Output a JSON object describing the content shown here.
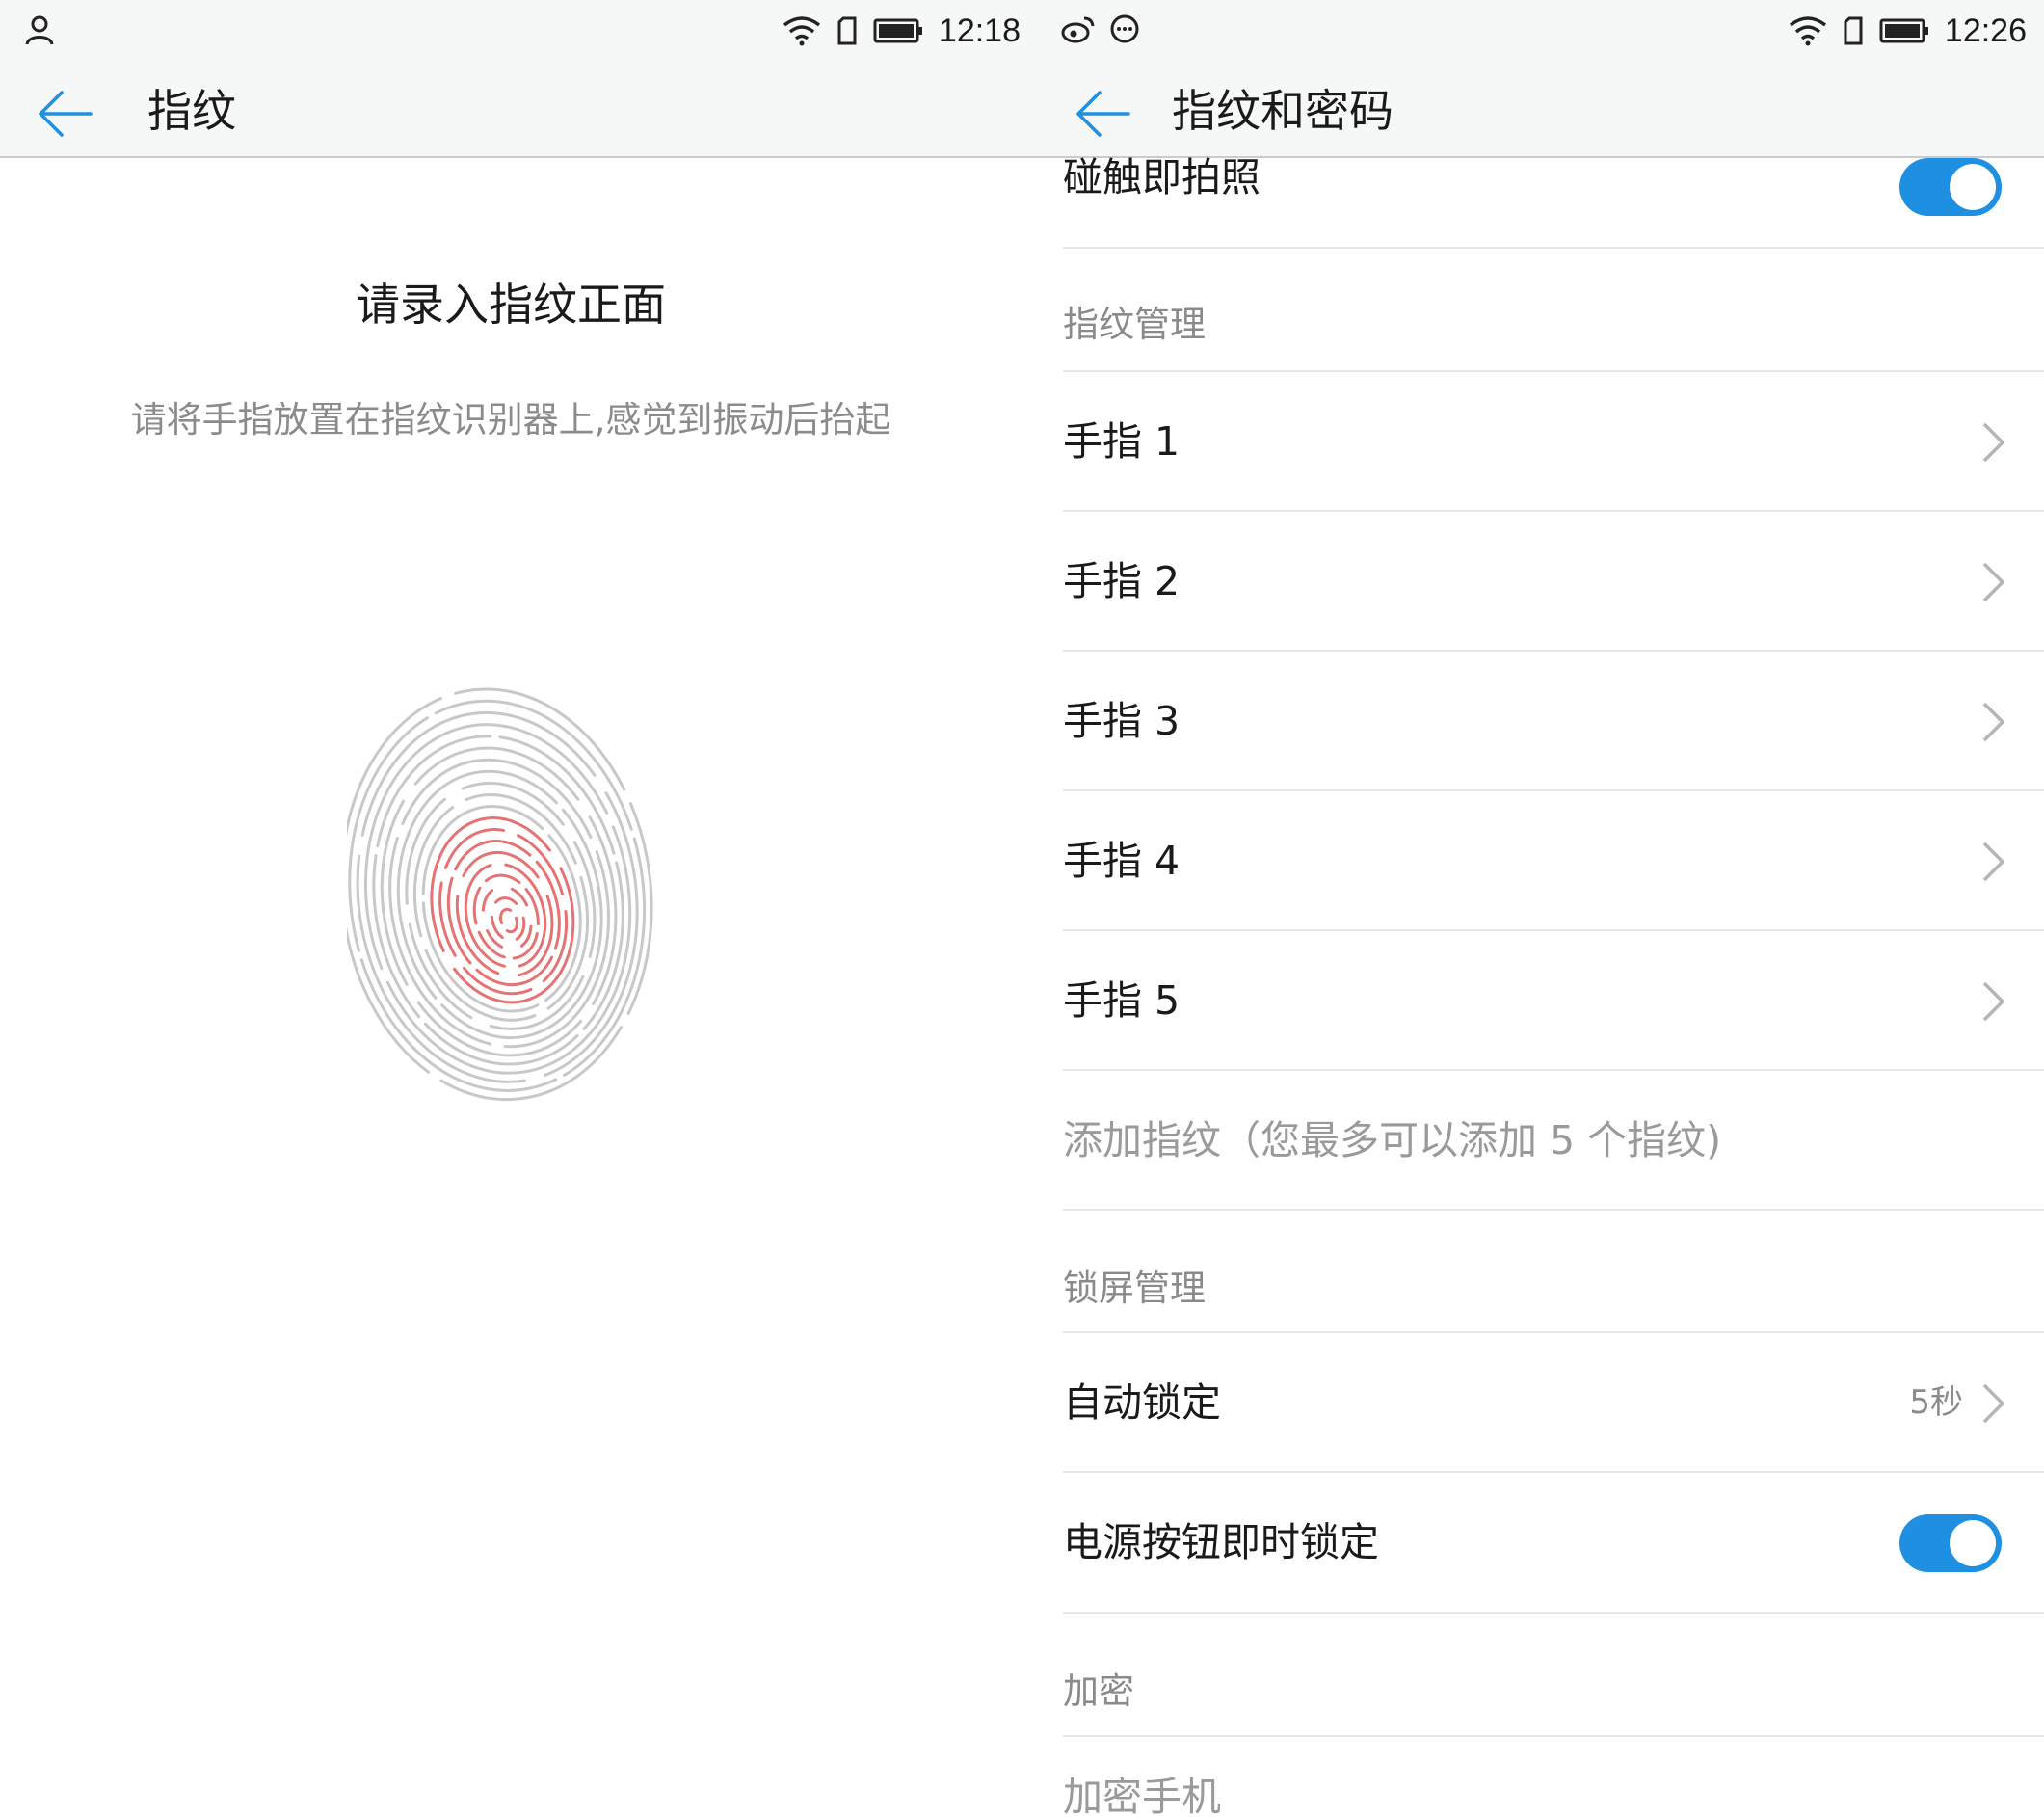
{
  "left": {
    "status": {
      "time": "12:18"
    },
    "appbar": {
      "title": "指纹"
    },
    "enroll": {
      "title": "请录入指纹正面",
      "instruction": "请将手指放置在指纹识别器上,感觉到振动后抬起"
    },
    "colors": {
      "accent": "#1e8fe1",
      "fingerprint_done": "#e57373",
      "fingerprint_todo": "#c8c8c8"
    },
    "fingerprint_progress": 0.45
  },
  "right": {
    "status": {
      "time": "12:26"
    },
    "appbar": {
      "title": "指纹和密码"
    },
    "rows": {
      "touch_photo": {
        "label": "碰触即拍照",
        "enabled": true
      },
      "section_fingerprint": "指纹管理",
      "fingers": [
        "手指 1",
        "手指 2",
        "手指 3",
        "手指 4",
        "手指 5"
      ],
      "add_fingerprint": "添加指纹（您最多可以添加 5 个指纹)",
      "section_lock": "锁屏管理",
      "auto_lock": {
        "label": "自动锁定",
        "value": "5秒"
      },
      "power_lock": {
        "label": "电源按钮即时锁定",
        "enabled": true
      },
      "section_encrypt": "加密",
      "encrypt_phone": "加密手机"
    },
    "colors": {
      "toggle_on": "#1e8fe1"
    }
  }
}
